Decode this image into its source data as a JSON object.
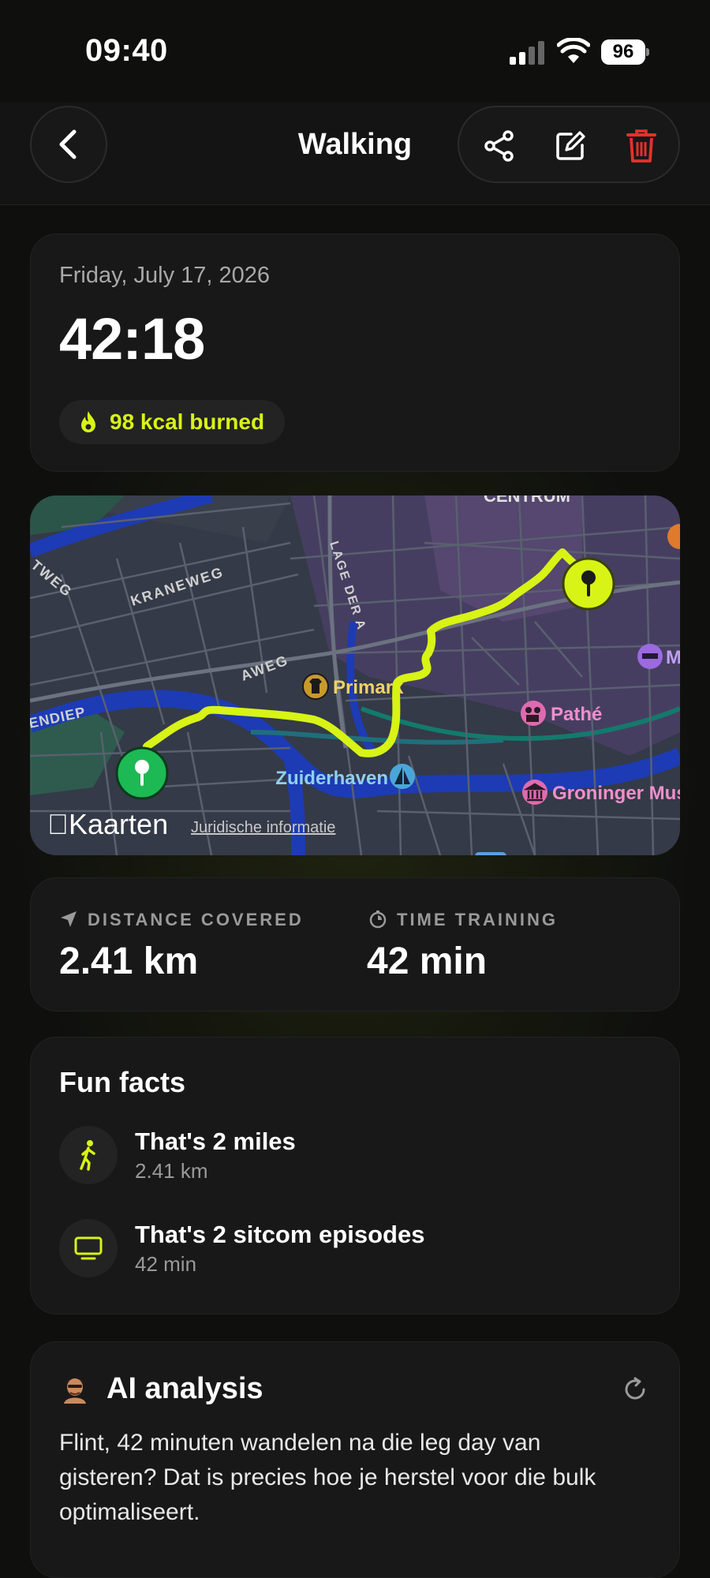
{
  "status_bar": {
    "time": "09:40",
    "battery": "96"
  },
  "header": {
    "title": "Walking"
  },
  "summary": {
    "date": "Friday, July 17, 2026",
    "duration": "42:18",
    "kcal_label": "98 kcal burned"
  },
  "map": {
    "attribution": "Kaarten",
    "legal_link": "Juridische informatie",
    "labels": {
      "centrum": "CENTRUM",
      "kraneweg": "KRANEWEG",
      "lage_der_a": "LAGE DER A",
      "aweg": "AWEG",
      "weg": "TWEG",
      "endiep": "ENDIEP",
      "primark": "Primark",
      "pathe": "Pathé",
      "zuiderhaven": "Zuiderhaven",
      "groninger": "Groninger Mus",
      "m": "M"
    },
    "colors": {
      "route": "#d8f316",
      "start_pin": "#1db954",
      "end_pin": "#d8f316"
    }
  },
  "stats": {
    "distance": {
      "label": "DISTANCE COVERED",
      "value": "2.41 km",
      "icon": "location-arrow-icon"
    },
    "time": {
      "label": "TIME TRAINING",
      "value": "42 min",
      "icon": "stopwatch-icon"
    }
  },
  "fun_facts": {
    "title": "Fun facts",
    "items": [
      {
        "title": "That's 2 miles",
        "subtitle": "2.41 km",
        "icon": "walking-person-icon"
      },
      {
        "title": "That's 2 sitcom episodes",
        "subtitle": "42 min",
        "icon": "tv-icon"
      }
    ]
  },
  "ai_analysis": {
    "title": "AI analysis",
    "text": "Flint, 42 minuten wandelen na die leg day van gisteren? Dat is precies hoe je herstel voor die bulk optimaliseert."
  },
  "colors": {
    "accent": "#d8f316",
    "danger": "#e5312b",
    "card": "#181818",
    "background": "#0f100e"
  }
}
